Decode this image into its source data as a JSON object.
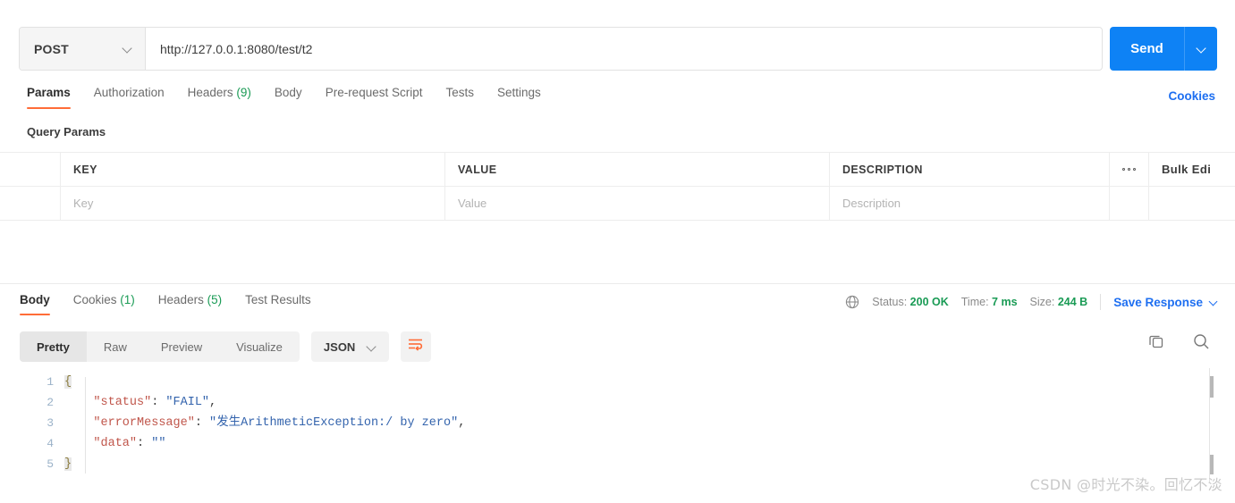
{
  "request": {
    "method": "POST",
    "method_icon": "chevron-down-icon",
    "url_value": "http://127.0.0.1:8080/test/t2",
    "url_placeholder": "Enter request URL",
    "send_label": "Send",
    "send_caret_icon": "chevron-down-icon",
    "tabs": [
      {
        "label": "Params",
        "count": "",
        "active": true
      },
      {
        "label": "Authorization",
        "count": "",
        "active": false
      },
      {
        "label": "Headers",
        "count": "(9)",
        "active": false
      },
      {
        "label": "Body",
        "count": "",
        "active": false
      },
      {
        "label": "Pre-request Script",
        "count": "",
        "active": false
      },
      {
        "label": "Tests",
        "count": "",
        "active": false
      },
      {
        "label": "Settings",
        "count": "",
        "active": false
      }
    ],
    "cookies_link": "Cookies"
  },
  "query_params": {
    "section_title": "Query Params",
    "columns": [
      "KEY",
      "VALUE",
      "DESCRIPTION"
    ],
    "more_icon": "three-dots-icon",
    "bulk_edit_label": "Bulk Edi",
    "rows": [
      {
        "key": "Key",
        "value": "Value",
        "description": "Description"
      }
    ]
  },
  "response": {
    "tabs": [
      {
        "label": "Body",
        "count": "",
        "active": true
      },
      {
        "label": "Cookies",
        "count": "(1)",
        "active": false
      },
      {
        "label": "Headers",
        "count": "(5)",
        "active": false
      },
      {
        "label": "Test Results",
        "count": "",
        "active": false
      }
    ],
    "status": {
      "globe_icon": "globe-icon",
      "status_label": "Status:",
      "status_value": "200 OK",
      "time_label": "Time:",
      "time_value": "7 ms",
      "size_label": "Size:",
      "size_value": "244 B",
      "save_response_label": "Save Response",
      "save_caret_icon": "chevron-down-icon"
    },
    "view_modes": [
      {
        "label": "Pretty",
        "active": true
      },
      {
        "label": "Raw",
        "active": false
      },
      {
        "label": "Preview",
        "active": false
      },
      {
        "label": "Visualize",
        "active": false
      }
    ],
    "format": "JSON",
    "format_caret_icon": "chevron-down-icon",
    "wrap_icon": "word-wrap-icon",
    "copy_icon": "copy-icon",
    "search_icon": "search-icon",
    "body_lines": [
      {
        "n": "1",
        "segments": [
          {
            "t": "{",
            "c": "brace"
          }
        ]
      },
      {
        "n": "2",
        "segments": [
          {
            "t": "    ",
            "c": "p"
          },
          {
            "t": "\"status\"",
            "c": "k"
          },
          {
            "t": ": ",
            "c": "p"
          },
          {
            "t": "\"FAIL\"",
            "c": "v"
          },
          {
            "t": ",",
            "c": "p"
          }
        ]
      },
      {
        "n": "3",
        "segments": [
          {
            "t": "    ",
            "c": "p"
          },
          {
            "t": "\"errorMessage\"",
            "c": "k"
          },
          {
            "t": ": ",
            "c": "p"
          },
          {
            "t": "\"发生ArithmeticException:/ by zero\"",
            "c": "v"
          },
          {
            "t": ",",
            "c": "p"
          }
        ]
      },
      {
        "n": "4",
        "segments": [
          {
            "t": "    ",
            "c": "p"
          },
          {
            "t": "\"data\"",
            "c": "k"
          },
          {
            "t": ": ",
            "c": "p"
          },
          {
            "t": "\"\"",
            "c": "v"
          }
        ]
      },
      {
        "n": "5",
        "segments": [
          {
            "t": "}",
            "c": "brace"
          }
        ]
      }
    ]
  },
  "watermark": "CSDN @时光不染。回忆不淡",
  "colors": {
    "accent_orange": "#ff6c37",
    "send_blue": "#0e82f5",
    "link_blue": "#1e6ff1",
    "status_green": "#1a9b55",
    "json_key": "#c0564b",
    "json_value": "#3464ad"
  }
}
